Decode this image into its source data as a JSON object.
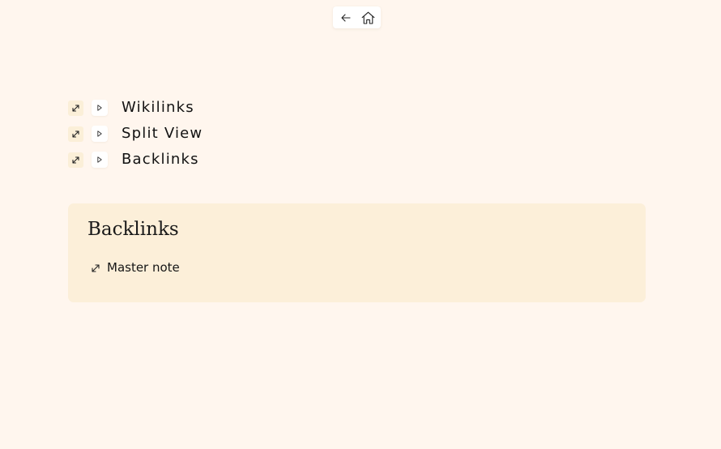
{
  "nav": {
    "back_icon": "arrow-left-icon",
    "home_icon": "home-icon"
  },
  "links": [
    {
      "label": "Wikilinks",
      "expand_icon": "expand-diagonal-icon",
      "play_icon": "play-triangle-icon"
    },
    {
      "label": "Split View",
      "expand_icon": "expand-diagonal-icon",
      "play_icon": "play-triangle-icon"
    },
    {
      "label": "Backlinks",
      "expand_icon": "expand-diagonal-icon",
      "play_icon": "play-triangle-icon"
    }
  ],
  "backlinks": {
    "title": "Backlinks",
    "items": [
      {
        "label": "Master note",
        "icon": "expand-diagonal-icon"
      }
    ]
  },
  "colors": {
    "page_background": "#fff6ee",
    "panel_background": "#fcefd9",
    "expand_button_background": "#fbefd8",
    "text": "#121212"
  }
}
